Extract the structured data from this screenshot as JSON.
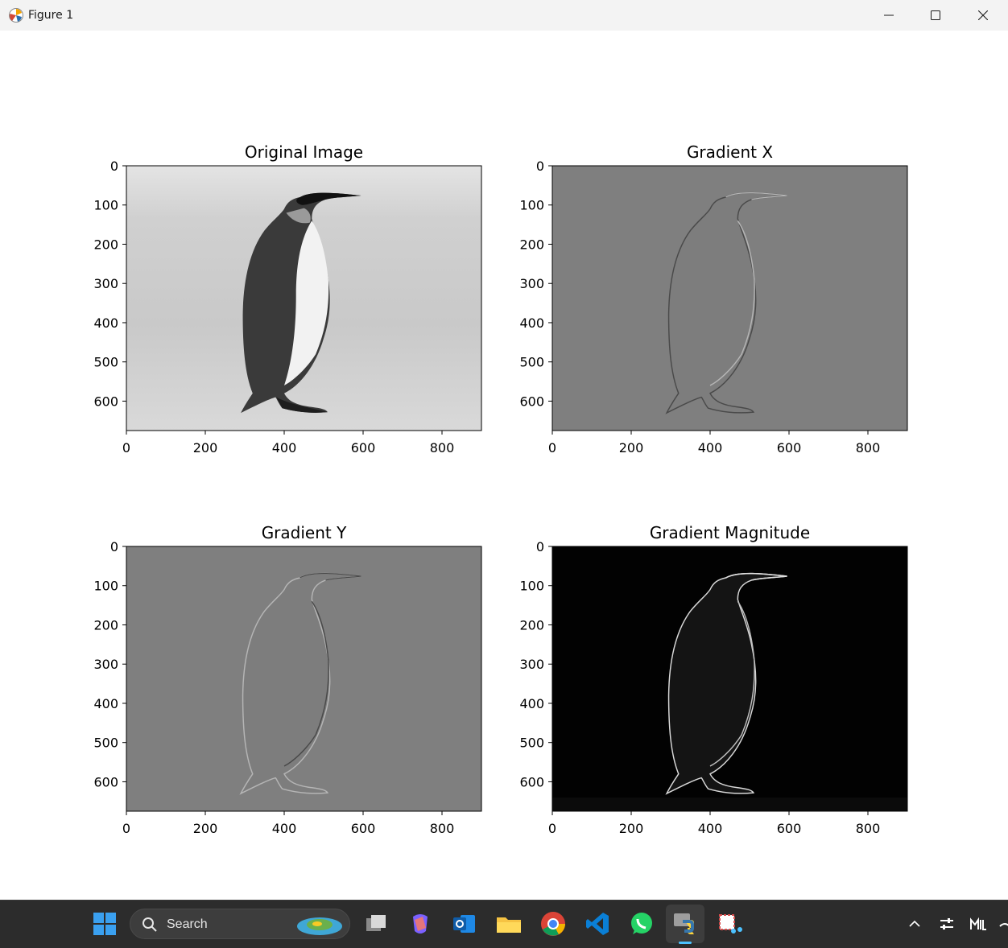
{
  "window": {
    "title": "Figure 1"
  },
  "icons": {
    "app": "matplotlib-icon",
    "minimize": "minimize-icon",
    "maximize": "maximize-icon",
    "close": "close-icon"
  },
  "chart_data": [
    {
      "type": "image",
      "title": "Original Image",
      "image": "grayscale photo of a king penguin standing on a light background",
      "xticks": [
        "0",
        "200",
        "400",
        "600",
        "800"
      ],
      "yticks": [
        "0",
        "100",
        "200",
        "300",
        "400",
        "500",
        "600"
      ],
      "xlim": [
        0,
        900
      ],
      "ylim": [
        675,
        0
      ]
    },
    {
      "type": "image",
      "title": "Gradient X",
      "image": "horizontal gradient of the penguin photo on mid-gray background",
      "xticks": [
        "0",
        "200",
        "400",
        "600",
        "800"
      ],
      "yticks": [
        "0",
        "100",
        "200",
        "300",
        "400",
        "500",
        "600"
      ],
      "xlim": [
        0,
        900
      ],
      "ylim": [
        675,
        0
      ]
    },
    {
      "type": "image",
      "title": "Gradient Y",
      "image": "vertical gradient of the penguin photo on mid-gray background",
      "xticks": [
        "0",
        "200",
        "400",
        "600",
        "800"
      ],
      "yticks": [
        "0",
        "100",
        "200",
        "300",
        "400",
        "500",
        "600"
      ],
      "xlim": [
        0,
        900
      ],
      "ylim": [
        675,
        0
      ]
    },
    {
      "type": "image",
      "title": "Gradient Magnitude",
      "image": "gradient magnitude of the penguin photo, bright edges on black background",
      "xticks": [
        "0",
        "200",
        "400",
        "600",
        "800"
      ],
      "yticks": [
        "0",
        "100",
        "200",
        "300",
        "400",
        "500",
        "600"
      ],
      "xlim": [
        0,
        900
      ],
      "ylim": [
        675,
        0
      ]
    }
  ],
  "taskbar": {
    "search_label": "Search",
    "icons": [
      "windows-start-icon",
      "search-icon",
      "task-view-icon",
      "copilot-icon",
      "outlook-icon",
      "file-explorer-icon",
      "chrome-icon",
      "vscode-icon",
      "whatsapp-icon",
      "python-icon",
      "snipping-tool-icon",
      "show-hidden-icons-chevron-icon",
      "settings-sliders-icon",
      "app-tray-icon"
    ]
  }
}
